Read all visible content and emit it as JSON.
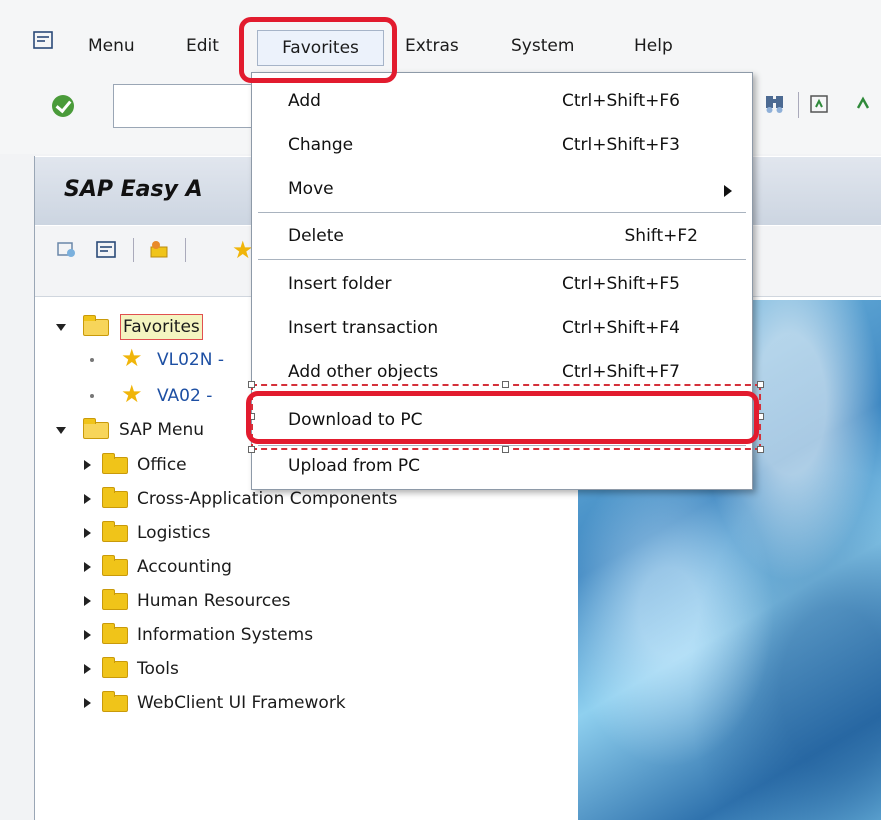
{
  "menubar": {
    "items": [
      {
        "label": "Menu"
      },
      {
        "label": "Edit"
      },
      {
        "label": "Favorites"
      },
      {
        "label": "Extras"
      },
      {
        "label": "System"
      },
      {
        "label": "Help"
      }
    ]
  },
  "panel": {
    "title": "SAP Easy A"
  },
  "tree": {
    "favorites_label": "Favorites",
    "favorite_items": [
      {
        "label": "VL02N -"
      },
      {
        "label": "VA02 -"
      }
    ],
    "sap_menu_label": "SAP Menu",
    "sap_menu_items": [
      {
        "label": "Office"
      },
      {
        "label": "Cross-Application Components"
      },
      {
        "label": "Logistics"
      },
      {
        "label": "Accounting"
      },
      {
        "label": "Human Resources"
      },
      {
        "label": "Information Systems"
      },
      {
        "label": "Tools"
      },
      {
        "label": "WebClient UI Framework"
      }
    ]
  },
  "favorites_menu": {
    "items": [
      {
        "label": "Add",
        "shortcut": "Ctrl+Shift+F6"
      },
      {
        "label": "Change",
        "shortcut": "Ctrl+Shift+F3"
      },
      {
        "label": "Move",
        "shortcut": ""
      },
      {
        "label": "Delete",
        "shortcut": "Shift+F2"
      },
      {
        "label": "Insert folder",
        "shortcut": "Ctrl+Shift+F5"
      },
      {
        "label": "Insert transaction",
        "shortcut": "Ctrl+Shift+F4"
      },
      {
        "label": "Add other objects",
        "shortcut": "Ctrl+Shift+F7"
      },
      {
        "label": "Download to PC",
        "shortcut": ""
      },
      {
        "label": "Upload from PC",
        "shortcut": ""
      }
    ]
  },
  "colors": {
    "highlight_red": "#e21b2e",
    "folder_yellow": "#f0c419",
    "star_gold": "#f0b50a",
    "ok_green": "#4a9b3a"
  },
  "icons": [
    "menu-icon",
    "ok-check-icon",
    "find-icon",
    "save-icon",
    "folder-icon",
    "star-icon",
    "submenu-arrow-icon"
  ]
}
